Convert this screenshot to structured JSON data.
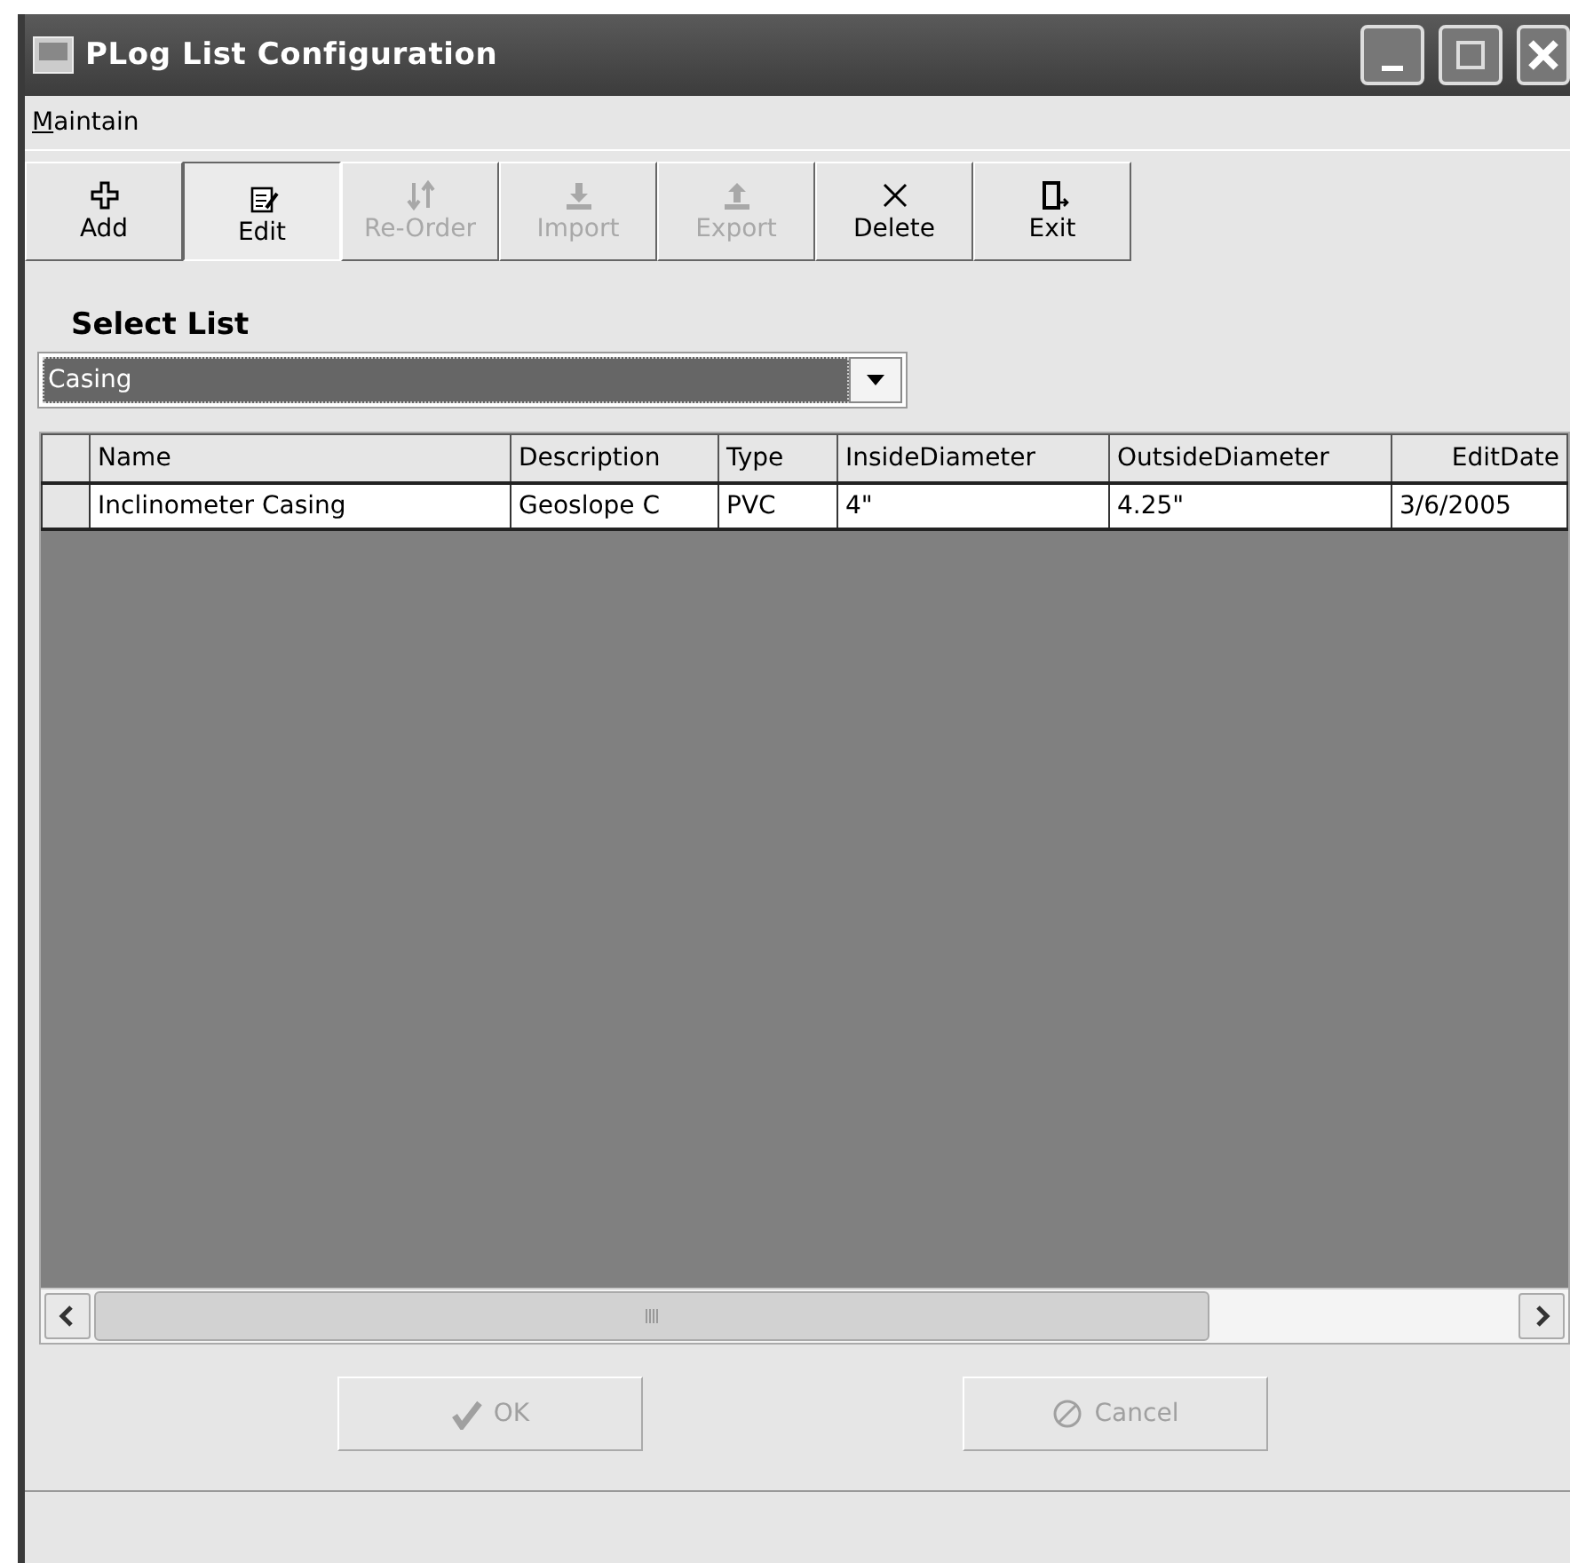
{
  "window": {
    "title": "PLog List Configuration"
  },
  "menu": [
    {
      "label": "Maintain"
    }
  ],
  "toolbar": [
    {
      "label": "Add",
      "disabled": false,
      "pressed": false
    },
    {
      "label": "Edit",
      "disabled": false,
      "pressed": true
    },
    {
      "label": "Re-Order",
      "disabled": true,
      "pressed": false
    },
    {
      "label": "Import",
      "disabled": true,
      "pressed": false
    },
    {
      "label": "Export",
      "disabled": true,
      "pressed": false
    },
    {
      "label": "Delete",
      "disabled": false,
      "pressed": false
    },
    {
      "label": "Exit",
      "disabled": false,
      "pressed": false
    }
  ],
  "select_list": {
    "label": "Select List",
    "value": "Casing"
  },
  "table": {
    "columns": [
      "Name",
      "Description",
      "Type",
      "InsideDiameter",
      "OutsideDiameter",
      "EditDate"
    ],
    "rows": [
      {
        "cells": [
          "Inclinometer Casing",
          "Geoslope C",
          "PVC",
          "4\"",
          "4.25\"",
          "3/6/2005"
        ]
      }
    ]
  },
  "buttons": [
    {
      "label": "OK",
      "disabled": true
    },
    {
      "label": "Cancel",
      "disabled": true
    }
  ]
}
